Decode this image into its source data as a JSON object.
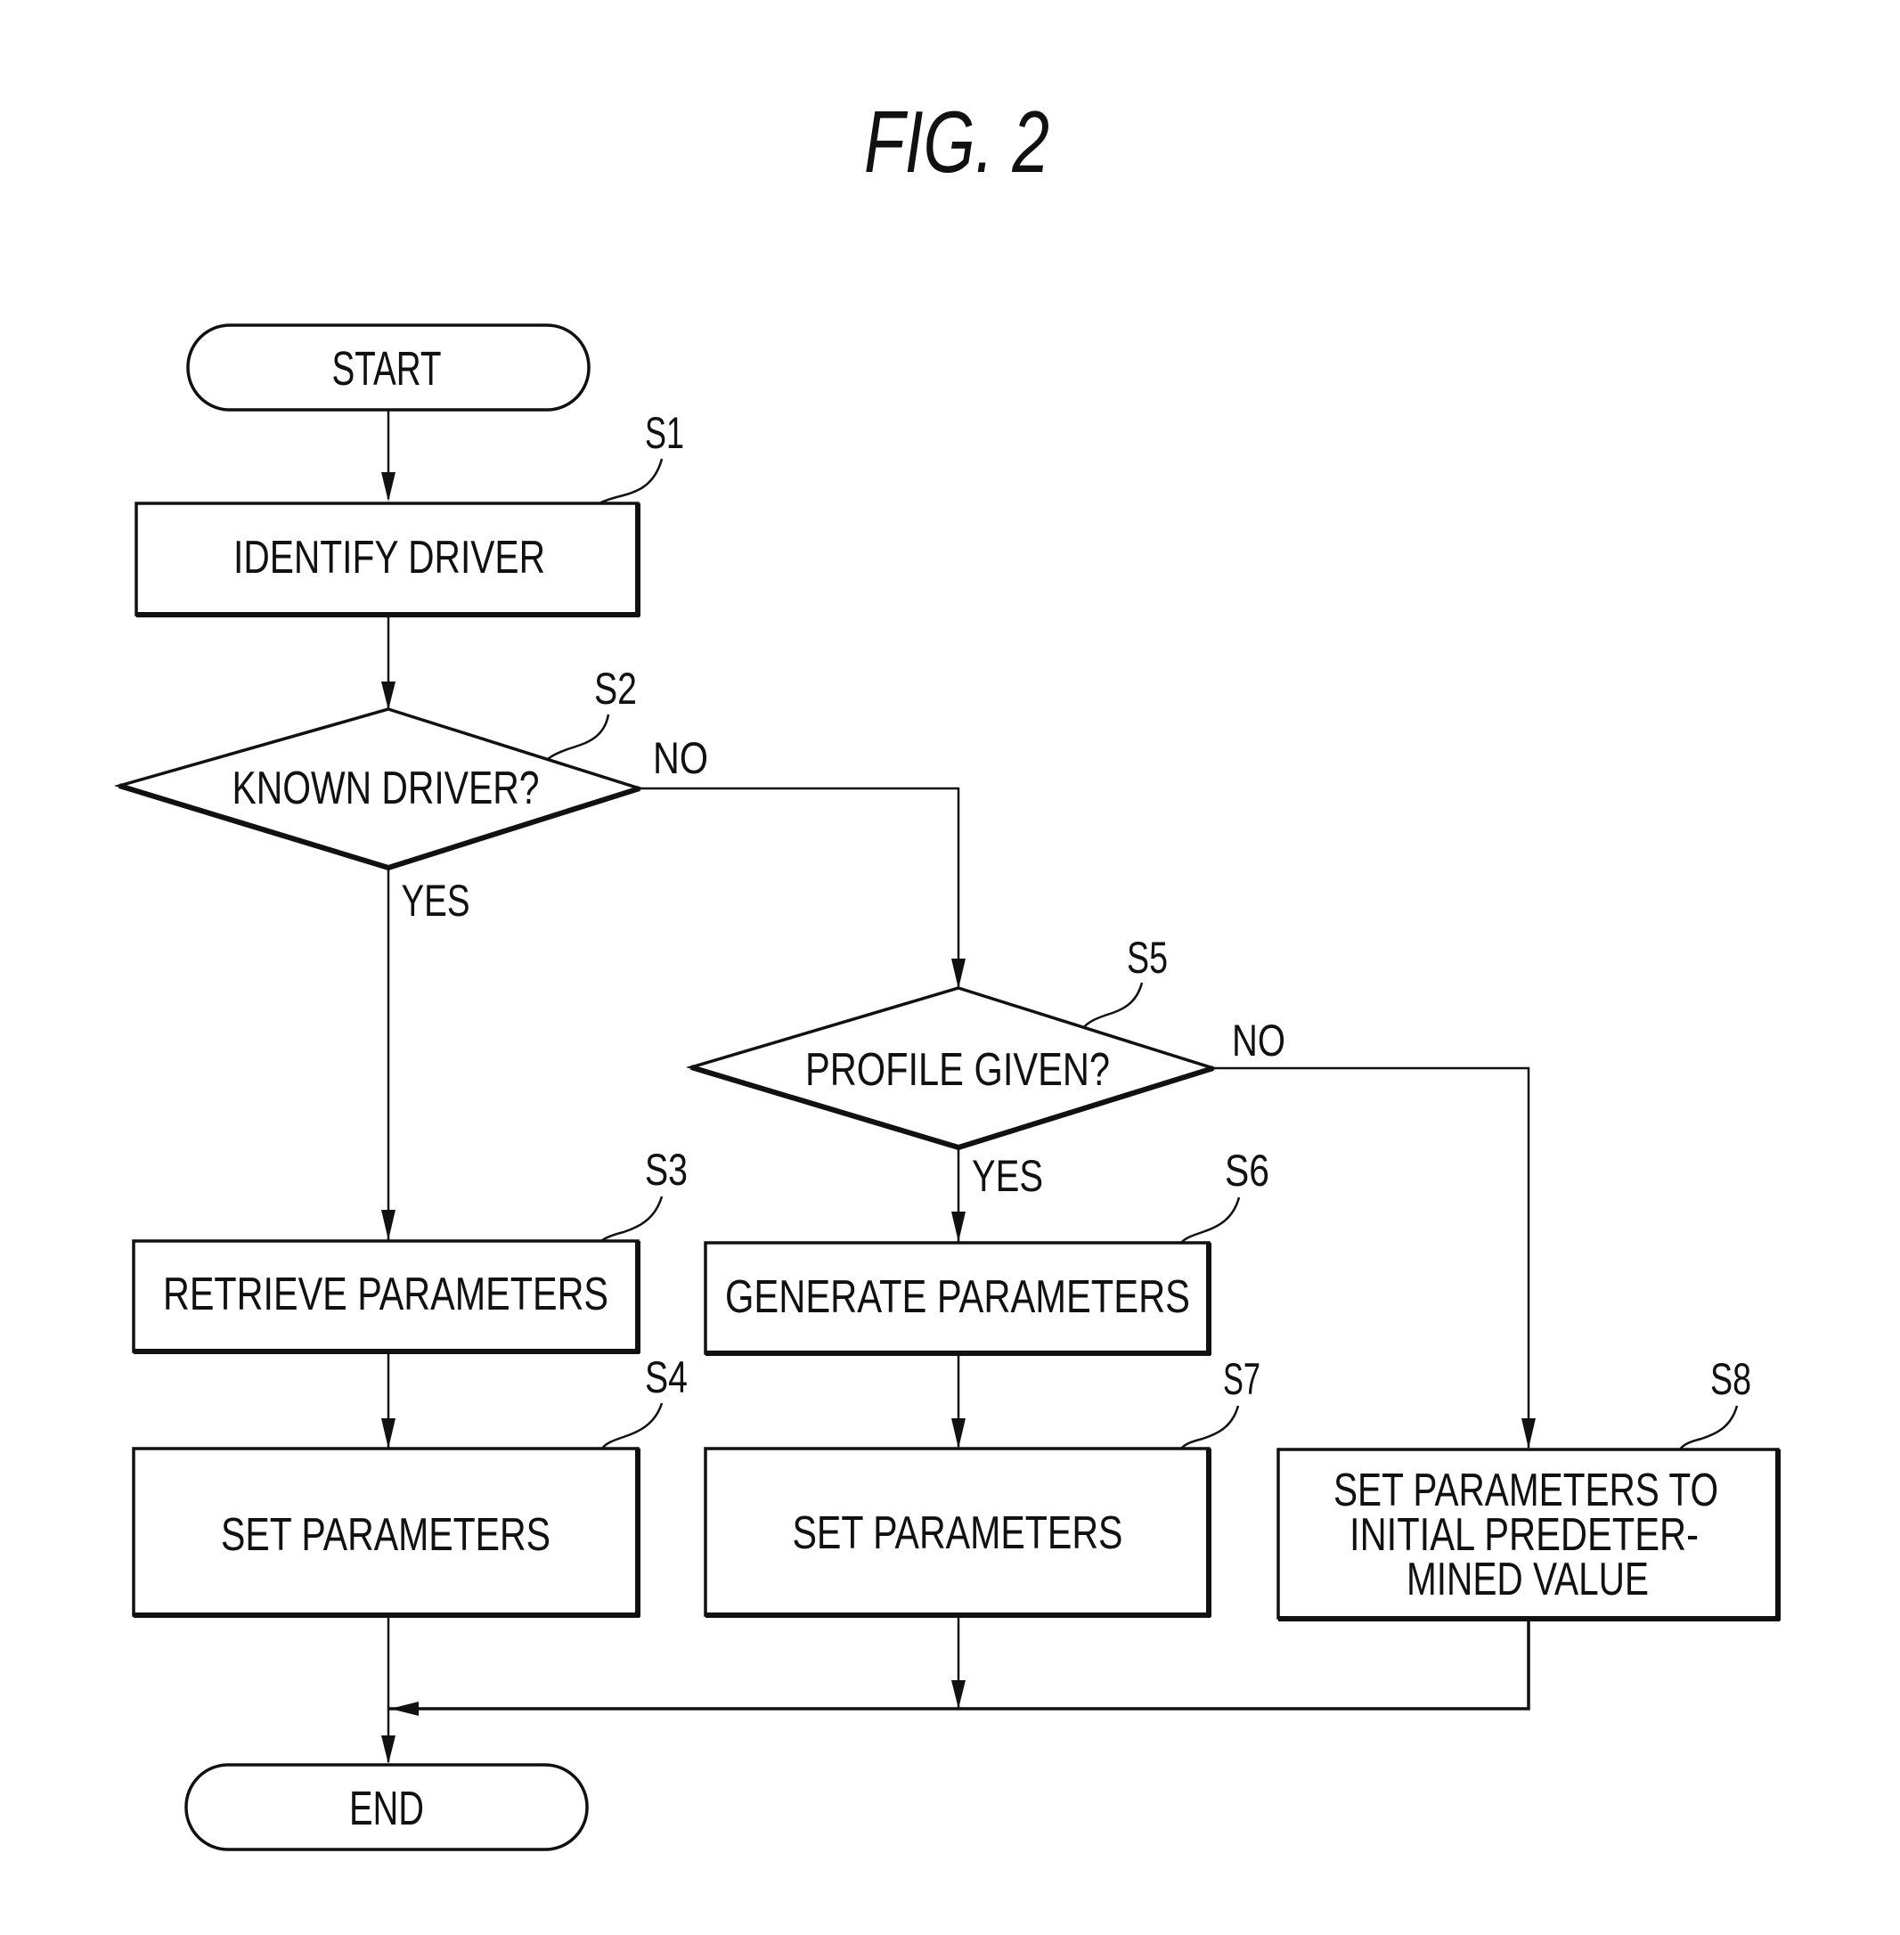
{
  "figure": {
    "title": "FIG. 2"
  },
  "nodes": {
    "start": {
      "label": "START"
    },
    "s1": {
      "step": "S1",
      "lines": [
        "IDENTIFY DRIVER"
      ]
    },
    "s2": {
      "step": "S2",
      "lines": [
        "KNOWN DRIVER?"
      ],
      "yes": "YES",
      "no": "NO"
    },
    "s3": {
      "step": "S3",
      "lines": [
        "RETRIEVE PARAMETERS"
      ]
    },
    "s4": {
      "step": "S4",
      "lines": [
        "SET PARAMETERS"
      ]
    },
    "s5": {
      "step": "S5",
      "lines": [
        "PROFILE GIVEN?"
      ],
      "yes": "YES",
      "no": "NO"
    },
    "s6": {
      "step": "S6",
      "lines": [
        "GENERATE PARAMETERS"
      ]
    },
    "s7": {
      "step": "S7",
      "lines": [
        "SET PARAMETERS"
      ]
    },
    "s8": {
      "step": "S8",
      "lines": [
        "SET PARAMETERS TO",
        "INITIAL PREDETER-",
        "MINED VALUE"
      ]
    },
    "end": {
      "label": "END"
    }
  },
  "edges": [
    {
      "from": "start",
      "to": "s1"
    },
    {
      "from": "s1",
      "to": "s2"
    },
    {
      "from": "s2",
      "to": "s3",
      "label": "YES"
    },
    {
      "from": "s2",
      "to": "s5",
      "label": "NO"
    },
    {
      "from": "s3",
      "to": "s4"
    },
    {
      "from": "s5",
      "to": "s6",
      "label": "YES"
    },
    {
      "from": "s5",
      "to": "s8",
      "label": "NO"
    },
    {
      "from": "s6",
      "to": "s7"
    },
    {
      "from": "s4",
      "to": "end"
    },
    {
      "from": "s7",
      "to": "end"
    },
    {
      "from": "s8",
      "to": "end"
    }
  ]
}
